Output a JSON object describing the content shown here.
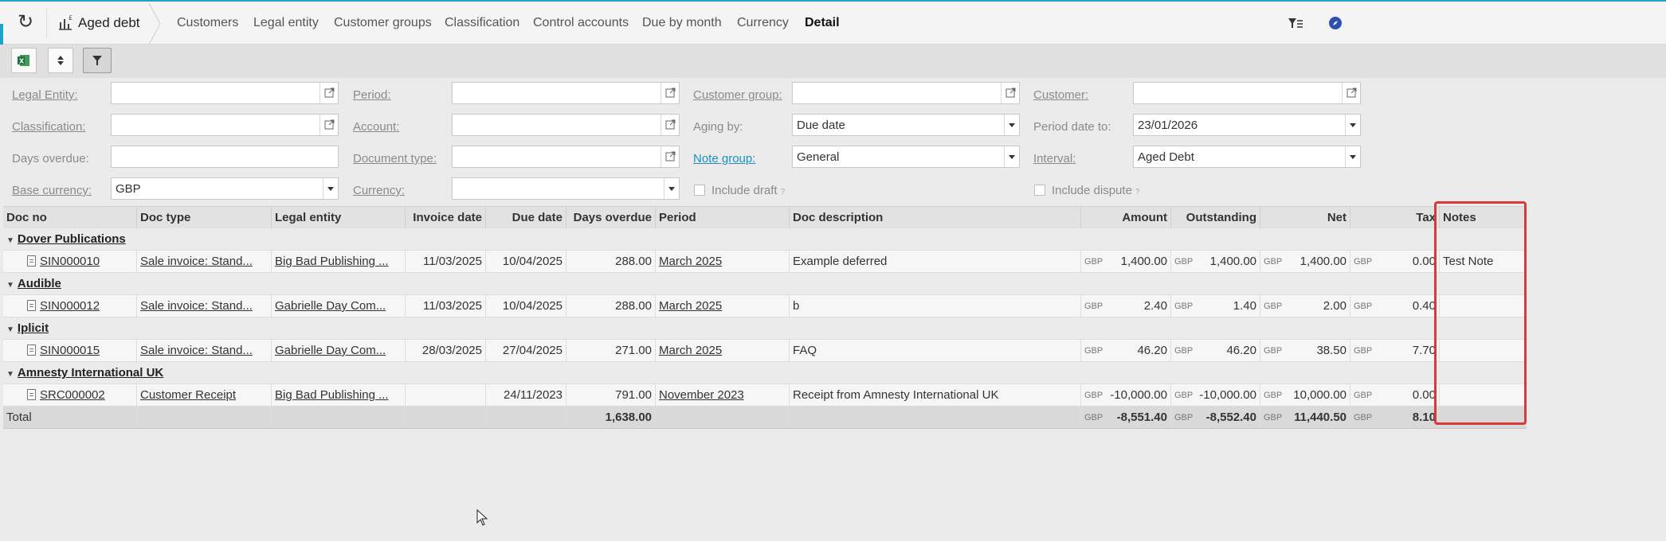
{
  "app": {
    "title": "Aged debt",
    "tabs": [
      {
        "label": "Customers"
      },
      {
        "label": "Legal entity"
      },
      {
        "label": "Customer groups"
      },
      {
        "label": "Classification"
      },
      {
        "label": "Control accounts"
      },
      {
        "label": "Due by month"
      },
      {
        "label": "Currency"
      },
      {
        "label": "Detail",
        "active": true
      }
    ],
    "accent_color": "#1fa3c6",
    "icons": {
      "refresh": "refresh-icon",
      "app": "bar-chart-icon",
      "right1": "filter-list-icon",
      "right2": "compass-icon"
    }
  },
  "toolbar": {
    "buttons": [
      {
        "name": "excel-export",
        "icon": "excel-icon"
      },
      {
        "name": "sort",
        "icon": "up-down-arrows-icon"
      },
      {
        "name": "filter",
        "icon": "funnel-icon",
        "pressed": true
      }
    ]
  },
  "filters": {
    "legal_entity": {
      "label": "Legal Entity:",
      "value": ""
    },
    "period": {
      "label": "Period:",
      "value": ""
    },
    "customer_group": {
      "label": "Customer group:",
      "value": ""
    },
    "customer": {
      "label": "Customer:",
      "value": ""
    },
    "classification": {
      "label": "Classification:",
      "value": ""
    },
    "account": {
      "label": "Account:",
      "value": ""
    },
    "aging_by": {
      "label": "Aging by:",
      "value": "Due date"
    },
    "period_date_to": {
      "label": "Period date to:",
      "value": "23/01/2026"
    },
    "days_overdue": {
      "label": "Days overdue:",
      "value": ""
    },
    "document_type": {
      "label": "Document type:",
      "value": ""
    },
    "note_group": {
      "label": "Note group:",
      "value": "General"
    },
    "interval": {
      "label": "Interval:",
      "value": "Aged Debt"
    },
    "base_currency": {
      "label": "Base currency:",
      "value": "GBP"
    },
    "currency": {
      "label": "Currency:",
      "value": ""
    },
    "include_draft": {
      "label": "Include draft",
      "checked": false
    },
    "include_dispute": {
      "label": "Include dispute",
      "checked": false
    },
    "help_mark": "?"
  },
  "grid": {
    "columns": [
      "Doc no",
      "Doc type",
      "Legal entity",
      "Invoice date",
      "Due date",
      "Days overdue",
      "Period",
      "Doc description",
      "Amount",
      "Outstanding",
      "Net",
      "Tax",
      "Notes"
    ],
    "groups": [
      {
        "name": "Dover Publications",
        "row": {
          "doc_no": "SIN000010",
          "doc_type": "Sale invoice: Stand...",
          "legal_entity": "Big Bad Publishing ...",
          "invoice_date": "11/03/2025",
          "due_date": "10/04/2025",
          "days_overdue": "288.00",
          "period": "March 2025",
          "description": "Example deferred",
          "cur": "GBP",
          "amount": "1,400.00",
          "outstanding": "1,400.00",
          "net": "1,400.00",
          "tax": "0.00",
          "notes": "Test Note"
        }
      },
      {
        "name": "Audible",
        "row": {
          "doc_no": "SIN000012",
          "doc_type": "Sale invoice: Stand...",
          "legal_entity": "Gabrielle Day Com...",
          "invoice_date": "11/03/2025",
          "due_date": "10/04/2025",
          "days_overdue": "288.00",
          "period": "March 2025",
          "description": "b",
          "cur": "GBP",
          "amount": "2.40",
          "outstanding": "1.40",
          "net": "2.00",
          "tax": "0.40",
          "notes": ""
        }
      },
      {
        "name": "Iplicit",
        "row": {
          "doc_no": "SIN000015",
          "doc_type": "Sale invoice: Stand...",
          "legal_entity": "Gabrielle Day Com...",
          "invoice_date": "28/03/2025",
          "due_date": "27/04/2025",
          "days_overdue": "271.00",
          "period": "March 2025",
          "description": "FAQ",
          "cur": "GBP",
          "amount": "46.20",
          "outstanding": "46.20",
          "net": "38.50",
          "tax": "7.70",
          "notes": ""
        }
      },
      {
        "name": "Amnesty International UK",
        "row": {
          "doc_no": "SRC000002",
          "doc_type": "Customer Receipt",
          "legal_entity": "Big Bad Publishing ...",
          "invoice_date": "",
          "due_date": "24/11/2023",
          "days_overdue": "791.00",
          "period": "November 2023",
          "description": "Receipt from Amnesty International UK",
          "cur": "GBP",
          "amount": "-10,000.00",
          "outstanding": "-10,000.00",
          "net": "10,000.00",
          "tax": "0.00",
          "notes": ""
        }
      }
    ],
    "total": {
      "label": "Total",
      "days_overdue": "1,638.00",
      "cur": "GBP",
      "amount": "-8,551.40",
      "outstanding": "-8,552.40",
      "net": "11,440.50",
      "tax": "8.10"
    }
  }
}
